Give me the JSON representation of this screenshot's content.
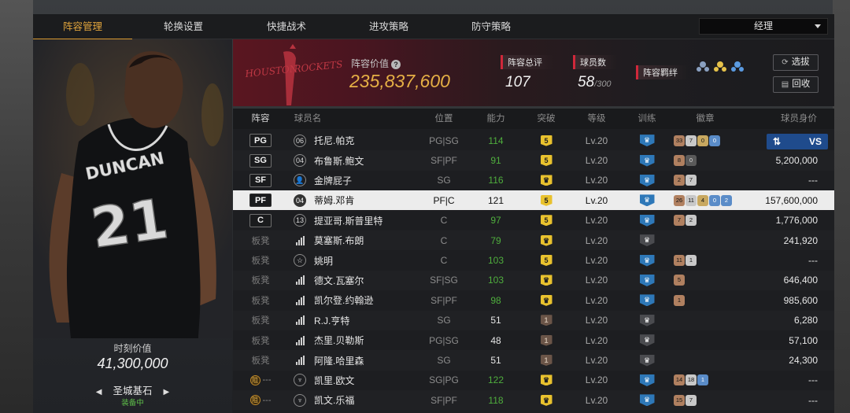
{
  "tabs": [
    "阵容管理",
    "轮换设置",
    "快捷战术",
    "进攻策略",
    "防守策略"
  ],
  "manager": "经理",
  "player": {
    "jersey_name": "DUNCAN",
    "jersey_number": "21",
    "value_label": "时刻价值",
    "value": "41,300,000",
    "card_name": "圣城基石",
    "status": "装备中"
  },
  "team": {
    "logo_city": "HOUSTON",
    "logo_name": "ROCKETS",
    "value_label": "阵容价值",
    "value": "235,837,600",
    "rating_label": "阵容总评",
    "rating": "107",
    "count_label": "球员数",
    "count": "58",
    "count_max": "/300",
    "bonds_label": "阵容羁绊"
  },
  "buttons": {
    "select": "选拔",
    "recycle": "回收",
    "vs": "VS"
  },
  "columns": [
    "阵容",
    "球员名",
    "位置",
    "能力",
    "突破",
    "等级",
    "训练",
    "徽章",
    "球员身价"
  ],
  "rows": [
    {
      "slot": "PG",
      "num": "06",
      "name": "托尼.帕克",
      "pos": "PG|SG",
      "ability": "114",
      "brk": "5",
      "lvl": "Lv.20",
      "badges": [
        "33",
        "7",
        "0",
        "0"
      ],
      "worth": ""
    },
    {
      "slot": "SG",
      "num": "04",
      "name": "布鲁斯.鲍文",
      "pos": "SF|PF",
      "ability": "91",
      "brk": "5",
      "lvl": "Lv.20",
      "badges": [
        "8",
        "0"
      ],
      "worth": "5,200,000"
    },
    {
      "slot": "SF",
      "num": "",
      "name": "金牌屁子",
      "pos": "SG",
      "ability": "116",
      "brk": "♛",
      "lvl": "Lv.20",
      "badges": [
        "2",
        "7"
      ],
      "worth": "---"
    },
    {
      "slot": "PF",
      "num": "04",
      "name": "蒂姆.邓肯",
      "pos": "PF|C",
      "ability": "121",
      "brk": "5",
      "lvl": "Lv.20",
      "badges": [
        "26",
        "11",
        "4",
        "0",
        "2"
      ],
      "worth": "157,600,000"
    },
    {
      "slot": "C",
      "num": "13",
      "name": "提亚哥.斯普里特",
      "pos": "C",
      "ability": "97",
      "brk": "5",
      "lvl": "Lv.20",
      "badges": [
        "7",
        "2"
      ],
      "worth": "1,776,000"
    },
    {
      "slot": "板凳",
      "num": "",
      "name": "莫塞斯.布朗",
      "pos": "C",
      "ability": "79",
      "brk": "♛",
      "lvl": "Lv.20",
      "badges": [],
      "worth": "241,920"
    },
    {
      "slot": "板凳",
      "num": "",
      "name": "姚明",
      "pos": "C",
      "ability": "103",
      "brk": "5",
      "lvl": "Lv.20",
      "badges": [
        "11",
        "1"
      ],
      "worth": "---"
    },
    {
      "slot": "板凳",
      "num": "",
      "name": "德文.瓦塞尔",
      "pos": "SF|SG",
      "ability": "103",
      "brk": "♛",
      "lvl": "Lv.20",
      "badges": [
        "5"
      ],
      "worth": "646,400"
    },
    {
      "slot": "板凳",
      "num": "",
      "name": "凯尔登.约翰逊",
      "pos": "SF|PF",
      "ability": "98",
      "brk": "♛",
      "lvl": "Lv.20",
      "badges": [
        "1"
      ],
      "worth": "985,600"
    },
    {
      "slot": "板凳",
      "num": "",
      "name": "R.J.亨特",
      "pos": "SG",
      "ability": "51",
      "brk": "1",
      "lvl": "Lv.20",
      "badges": [],
      "worth": "6,280"
    },
    {
      "slot": "板凳",
      "num": "",
      "name": "杰里.贝勒斯",
      "pos": "PG|SG",
      "ability": "48",
      "brk": "1",
      "lvl": "Lv.20",
      "badges": [],
      "worth": "57,100"
    },
    {
      "slot": "板凳",
      "num": "",
      "name": "阿隆.哈里森",
      "pos": "SG",
      "ability": "51",
      "brk": "1",
      "lvl": "Lv.20",
      "badges": [],
      "worth": "24,300"
    },
    {
      "slot": "---",
      "num": "",
      "name": "凯里.欧文",
      "pos": "SG|PG",
      "ability": "122",
      "brk": "♛",
      "lvl": "Lv.20",
      "badges": [
        "14",
        "18",
        "1"
      ],
      "worth": "---"
    },
    {
      "slot": "---",
      "num": "",
      "name": "凯文.乐福",
      "pos": "SF|PF",
      "ability": "118",
      "brk": "♛",
      "lvl": "Lv.20",
      "badges": [
        "15",
        "7"
      ],
      "worth": "---"
    }
  ]
}
